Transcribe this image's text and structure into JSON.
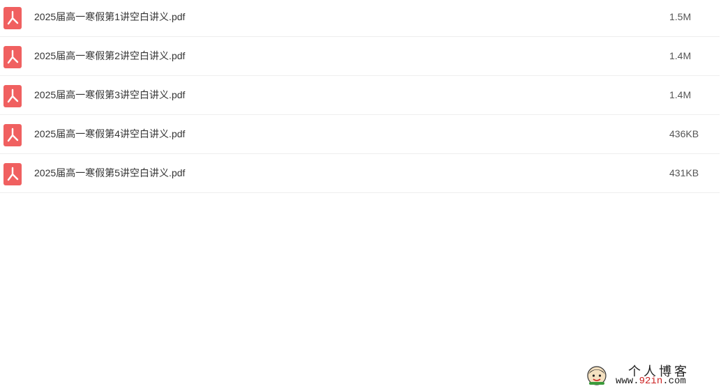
{
  "colors": {
    "pdf_icon": "#f06060",
    "row_divider": "#eeeeee",
    "watermark_accent": "#cc2222"
  },
  "files": [
    {
      "icon": "pdf-icon",
      "name": "2025届高一寒假第1讲空白讲义.pdf",
      "size": "1.5M"
    },
    {
      "icon": "pdf-icon",
      "name": "2025届高一寒假第2讲空白讲义.pdf",
      "size": "1.4M"
    },
    {
      "icon": "pdf-icon",
      "name": "2025届高一寒假第3讲空白讲义.pdf",
      "size": "1.4M"
    },
    {
      "icon": "pdf-icon",
      "name": "2025届高一寒假第4讲空白讲义.pdf",
      "size": "436KB"
    },
    {
      "icon": "pdf-icon",
      "name": "2025届高一寒假第5讲空白讲义.pdf",
      "size": "431KB"
    }
  ],
  "watermark": {
    "title": "个人博客",
    "url_prefix": "www.",
    "url_accent": "92in",
    "url_suffix": ".com"
  }
}
